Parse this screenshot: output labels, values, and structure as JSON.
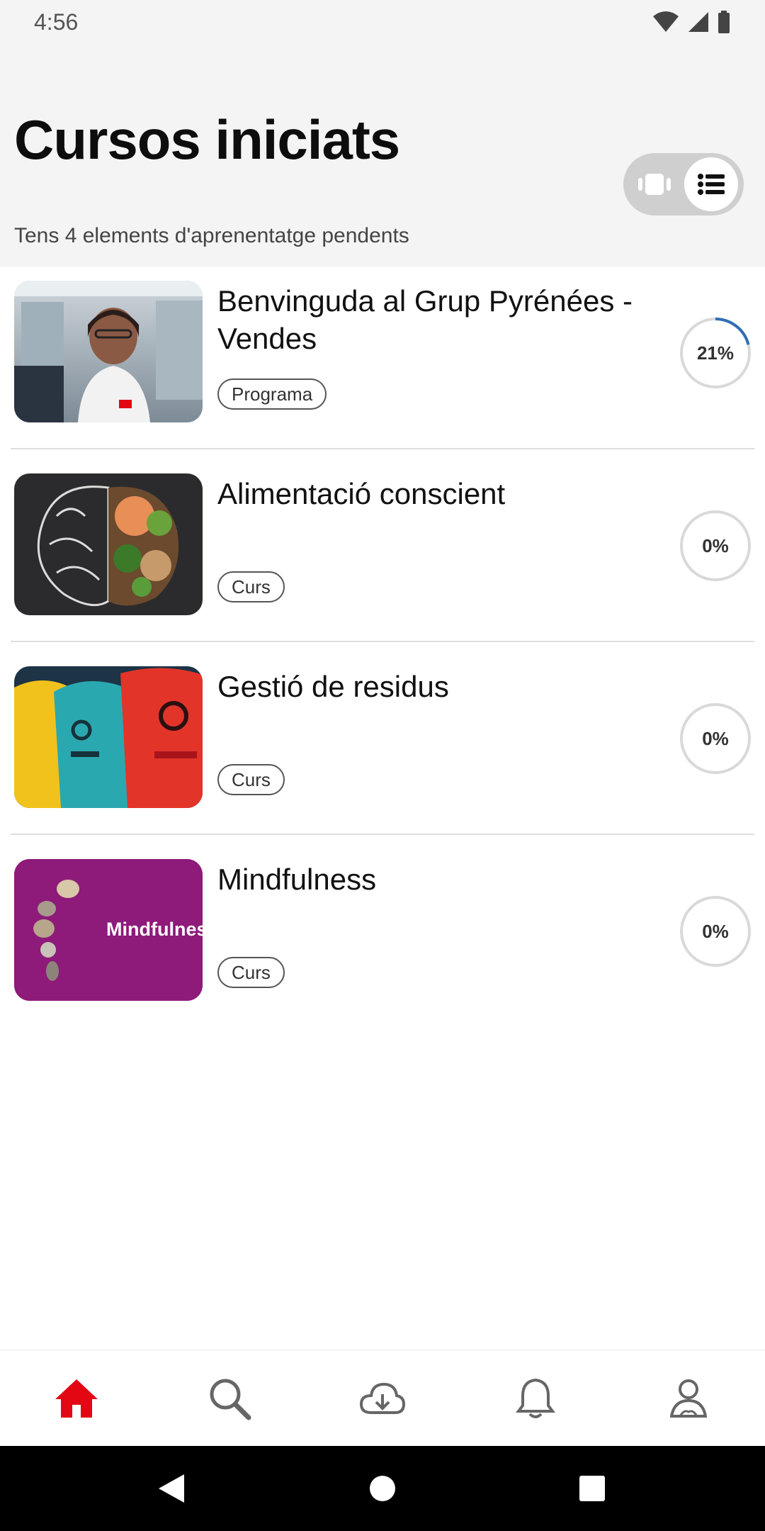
{
  "status_bar": {
    "time": "4:56"
  },
  "header": {
    "title": "Cursos iniciats",
    "subtitle": "Tens 4 elements d'aprenentatge pendents"
  },
  "courses": [
    {
      "title": "Benvinguda al Grup Pyrénées - Vendes",
      "tag": "Programa",
      "progress_label": "21%",
      "progress": 0.21,
      "thumbnail": "person-photo"
    },
    {
      "title": "Alimentació conscient",
      "tag": "Curs",
      "progress_label": "0%",
      "progress": 0,
      "thumbnail": "brain-food-photo"
    },
    {
      "title": "Gestió de residus",
      "tag": "Curs",
      "progress_label": "0%",
      "progress": 0,
      "thumbnail": "recycling-bins-photo"
    },
    {
      "title": "Mindfulness",
      "tag": "Curs",
      "progress_label": "0%",
      "progress": 0,
      "thumbnail": "mindfulness-stones",
      "thumbnail_text": "Mindfulness"
    }
  ],
  "bottom_nav": [
    "home-icon",
    "search-icon",
    "cloud-download-icon",
    "bell-icon",
    "profile-icon"
  ],
  "colors": {
    "accent": "#e30613",
    "progress": "#2f6fb3",
    "ring": "#d9d9d9",
    "header_bg": "#f4f4f4",
    "mindfulness_bg": "#8e1a7a"
  }
}
